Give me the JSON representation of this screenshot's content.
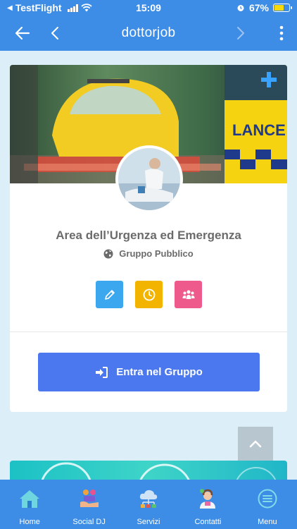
{
  "status_bar": {
    "carrier": "TestFlight",
    "time": "15:09",
    "battery": "67%",
    "battery_level": 0.67
  },
  "app_bar": {
    "title": "dottorjob",
    "icons": [
      "back-arrow-icon",
      "chevron-left-icon",
      "chevron-right-icon",
      "more-vertical-icon"
    ]
  },
  "group": {
    "title": "Area dell’Urgenza ed Emergenza",
    "type": "Gruppo Pubblico",
    "type_icon": "globe-icon",
    "actions": [
      {
        "name": "edit",
        "icon": "pencil-icon",
        "color": "#3aa7ef"
      },
      {
        "name": "history",
        "icon": "clock-icon",
        "color": "#f3b400"
      },
      {
        "name": "members",
        "icon": "users-icon",
        "color": "#ef5a8c"
      }
    ],
    "join_label": "Entra nel Gruppo",
    "join_icon": "sign-in-icon",
    "join_color": "#4b78ef"
  },
  "tabs": [
    {
      "label": "Home",
      "icon": "home-icon"
    },
    {
      "label": "Social DJ",
      "icon": "social-hands-icon"
    },
    {
      "label": "Servizi",
      "icon": "cloud-network-icon"
    },
    {
      "label": "Contatti",
      "icon": "support-agent-icon"
    },
    {
      "label": "Menu",
      "icon": "menu-circle-icon"
    }
  ],
  "colors": {
    "primary": "#3d8de6",
    "background": "#dceef8"
  }
}
